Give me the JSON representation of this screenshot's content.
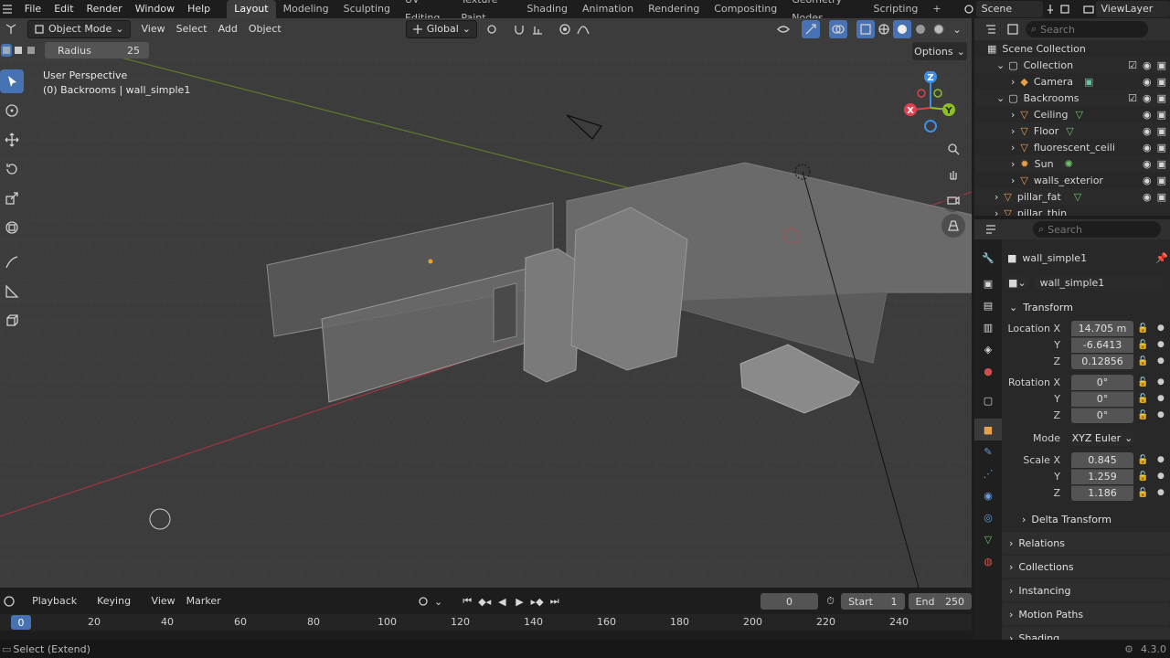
{
  "menu": [
    "File",
    "Edit",
    "Render",
    "Window",
    "Help"
  ],
  "workspaces": [
    "Layout",
    "Modeling",
    "Sculpting",
    "UV Editing",
    "Texture Paint",
    "Shading",
    "Animation",
    "Rendering",
    "Compositing",
    "Geometry Nodes",
    "Scripting"
  ],
  "active_workspace": "Layout",
  "add_workspace": "+",
  "scene_name": "Scene",
  "view_layer": "ViewLayer",
  "viewport": {
    "mode": "Object Mode",
    "menus": [
      "View",
      "Select",
      "Add",
      "Object"
    ],
    "orientation": "Global",
    "radius_label": "Radius",
    "radius_value": "25",
    "options": "Options",
    "perspective": "User Perspective",
    "context": "(0) Backrooms | wall_simple1"
  },
  "gizmo": {
    "z": "Z",
    "y": "Y",
    "x": "X"
  },
  "outliner": {
    "search_placeholder": "Search",
    "rows": [
      {
        "label": "Scene Collection",
        "type": "scene"
      },
      {
        "label": "Collection",
        "type": "collection"
      },
      {
        "label": "Camera",
        "type": "camera"
      },
      {
        "label": "Backrooms",
        "type": "collection"
      },
      {
        "label": "Ceiling",
        "type": "mesh"
      },
      {
        "label": "Floor",
        "type": "mesh"
      },
      {
        "label": "fluorescent_ceiling",
        "type": "mesh"
      },
      {
        "label": "Sun",
        "type": "light"
      },
      {
        "label": "walls_exterior",
        "type": "mesh"
      },
      {
        "label": "pillar_fat",
        "type": "mesh"
      },
      {
        "label": "pillar_thin",
        "type": "mesh"
      }
    ]
  },
  "properties": {
    "search_placeholder": "Search",
    "object_name": "wall_simple1",
    "datablock_name": "wall_simple1",
    "transform_title": "Transform",
    "location_label": "Location X",
    "location": [
      "14.705 m",
      "-6.6413",
      "0.12856"
    ],
    "rotation_label": "Rotation X",
    "rotation": [
      "0°",
      "0°",
      "0°"
    ],
    "mode_label": "Mode",
    "mode_value": "XYZ Euler",
    "scale_label": "Scale X",
    "scale": [
      "0.845",
      "1.259",
      "1.186"
    ],
    "axis_y": "Y",
    "axis_z": "Z",
    "delta_transform": "Delta Transform",
    "panels": [
      "Relations",
      "Collections",
      "Instancing",
      "Motion Paths",
      "Shading"
    ]
  },
  "timeline": {
    "menus": [
      "Playback",
      "Keying",
      "View",
      "Marker"
    ],
    "current_frame": "0",
    "start_label": "Start",
    "start_value": "1",
    "end_label": "End",
    "end_value": "250",
    "ticks": [
      "0",
      "20",
      "40",
      "60",
      "80",
      "100",
      "120",
      "140",
      "160",
      "180",
      "200",
      "220",
      "240"
    ]
  },
  "status": {
    "left": "Select (Extend)",
    "version": "4.3.0"
  },
  "colors": {
    "accent": "#4772b3",
    "x_axis": "#e04050",
    "y_axis": "#8cbf26",
    "z_axis": "#3b8fe6"
  }
}
